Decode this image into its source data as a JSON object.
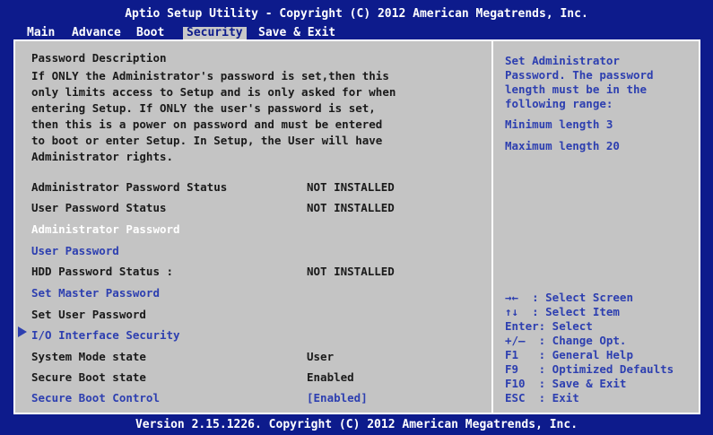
{
  "header": {
    "title": "Aptio Setup Utility - Copyright (C) 2012 American Megatrends, Inc."
  },
  "menu": {
    "items": [
      "Main",
      "Advance",
      "Boot",
      "Security",
      "Save & Exit"
    ],
    "active": "Security"
  },
  "main": {
    "section_title": "Password Description",
    "description": [
      "If ONLY the Administrator's password is set,then this",
      "only limits access to Setup and is only asked for when",
      "entering Setup. If ONLY the user's password is set,",
      "then this is a power on password and must be entered",
      "to boot or enter Setup. In Setup, the User will have",
      "Administrator rights."
    ],
    "rows": [
      {
        "label": "Administrator Password Status",
        "value": "NOT INSTALLED"
      },
      {
        "label": "User Password Status",
        "value": "NOT INSTALLED"
      },
      {
        "label": "Administrator Password",
        "value": ""
      },
      {
        "label": "User Password",
        "value": ""
      },
      {
        "label": "HDD Password Status :",
        "value": "NOT INSTALLED"
      },
      {
        "label": "Set Master Password",
        "value": ""
      },
      {
        "label": "Set User Password",
        "value": ""
      },
      {
        "label": "I/O Interface Security",
        "value": ""
      },
      {
        "label": "System Mode state",
        "value": "User"
      },
      {
        "label": "Secure Boot state",
        "value": "Enabled"
      },
      {
        "label": "Secure Boot Control",
        "value": "[Enabled]"
      }
    ]
  },
  "help": {
    "lines": [
      "Set Administrator",
      "Password. The password",
      "length must be in the",
      "following range:"
    ],
    "min_length": "Minimum length 3",
    "max_length": "Maximum length 20"
  },
  "keys": [
    "→←  : Select Screen",
    "↑↓  : Select Item",
    "Enter: Select",
    "+/—  : Change Opt.",
    "F1   : General Help",
    "F9   : Optimized Defaults",
    "F10  : Save & Exit",
    "ESC  : Exit"
  ],
  "footer": {
    "text": "Version 2.15.1226. Copyright (C) 2012 American Megatrends, Inc."
  },
  "colors": {
    "background": "#0d1b8c",
    "panel": "#c4c4c4",
    "highlight_text": "#2d3fb0",
    "selected_text": "#ffffff"
  }
}
